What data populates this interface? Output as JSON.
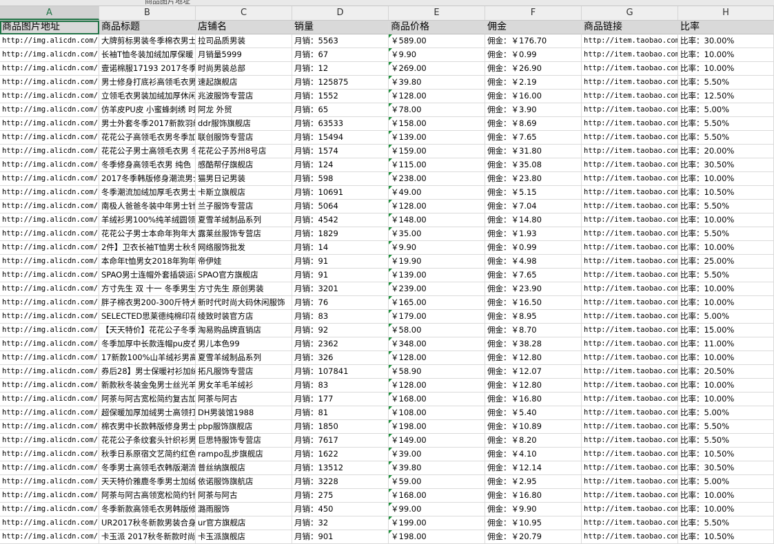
{
  "formula_bar": {
    "cell_text": "商品图片地址"
  },
  "columns": [
    "A",
    "B",
    "C",
    "D",
    "E",
    "F",
    "G",
    "H"
  ],
  "headers": [
    "商品图片地址",
    "商品标题",
    "店铺名",
    "销量",
    "商品价格",
    "佣金",
    "商品链接",
    "比率"
  ],
  "rows": [
    [
      "http://img.alicdn.com/ba",
      "大牌剪标男装冬季棉衣男士",
      "拉司品质男装",
      "月销：5563",
      "￥589.00",
      "佣金：￥176.70",
      "http://item.taobao.com/i",
      "比率：30.00%"
    ],
    [
      "http://img.alicdn.com/ba",
      "长袖T恤冬装加绒加厚保暖",
      "月销量5999",
      "月销：67",
      "￥9.90",
      "佣金：￥0.99",
      "http://item.taobao.com/i",
      "比率：10.00%"
    ],
    [
      "http://img.alicdn.com/ba",
      "壹诺棉服17193 2017冬季男",
      "时尚男装总部",
      "月销：12",
      "￥269.00",
      "佣金：￥26.90",
      "http://item.taobao.com/i",
      "比率：10.00%"
    ],
    [
      "http://img.alicdn.com/ba",
      "男士修身打底衫高领毛衣男",
      "速起旗舰店",
      "月销：125875",
      "￥39.80",
      "佣金：￥2.19",
      "http://item.taobao.com/i",
      "比率：5.50%"
    ],
    [
      "http://img.alicdn.com/ba",
      "立领毛衣男装加绒加厚休闲",
      "兆波服饰专营店",
      "月销：1552",
      "￥128.00",
      "佣金：￥16.00",
      "http://item.taobao.com/i",
      "比率：12.50%"
    ],
    [
      "http://img.alicdn.com/ba",
      "仿羊皮PU皮 小蜜蜂刺绣 时",
      "阿龙 外贸",
      "月销：65",
      "￥78.00",
      "佣金：￥3.90",
      "http://item.taobao.com/i",
      "比率：5.00%"
    ],
    [
      "http://img.alicdn.com/ba",
      "男士外套冬季2017新款羽绒",
      "ddr服饰旗舰店",
      "月销：63533",
      "￥158.00",
      "佣金：￥8.69",
      "http://item.taobao.com/i",
      "比率：5.50%"
    ],
    [
      "http://img.alicdn.com/ba",
      "花花公子高领毛衣男冬季加",
      "联创服饰专营店",
      "月销：15494",
      "￥139.00",
      "佣金：￥7.65",
      "http://item.taobao.com/i",
      "比率：5.50%"
    ],
    [
      "http://img.alicdn.com/ba",
      "花花公子男士高领毛衣男 冬",
      "花花公子苏州8号店",
      "月销：1574",
      "￥159.00",
      "佣金：￥31.80",
      "http://item.taobao.com/i",
      "比率：20.00%"
    ],
    [
      "http://img.alicdn.com/ba",
      "冬季修身高领毛衣男 纯色",
      "感酷帮仔旗舰店",
      "月销：124",
      "￥115.00",
      "佣金：￥35.08",
      "http://item.taobao.com/i",
      "比率：30.50%"
    ],
    [
      "http://img.alicdn.com/ba",
      "2017冬季韩版修身潮流男士",
      "猫男日记男装",
      "月销：598",
      "￥238.00",
      "佣金：￥23.80",
      "http://item.taobao.com/i",
      "比率：10.00%"
    ],
    [
      "http://img.alicdn.com/ba",
      "冬季潮流加绒加厚毛衣男士",
      "卡斯立旗舰店",
      "月销：10691",
      "￥49.00",
      "佣金：￥5.15",
      "http://item.taobao.com/i",
      "比率：10.50%"
    ],
    [
      "http://img.alicdn.com/ba",
      "南极人爸爸冬装中年男士针",
      "兰子服饰专营店",
      "月销：5064",
      "￥128.00",
      "佣金：￥7.04",
      "http://item.taobao.com/i",
      "比率：5.50%"
    ],
    [
      "http://img.alicdn.com/ba",
      "羊绒衫男100%纯羊绒圆领羊",
      "夏雪羊绒制品系列",
      "月销：4542",
      "￥148.00",
      "佣金：￥14.80",
      "http://item.taobao.com/i",
      "比率：10.00%"
    ],
    [
      "http://img.alicdn.com/ba",
      "花花公子男士本命年狗年大",
      "露莱丝服饰专营店",
      "月销：1829",
      "￥35.00",
      "佣金：￥1.93",
      "http://item.taobao.com/i",
      "比率：5.50%"
    ],
    [
      "http://img.alicdn.com/ba",
      "2件】卫衣长袖T恤男士秋冬",
      "网络服饰批发",
      "月销：14",
      "￥9.90",
      "佣金：￥0.99",
      "http://item.taobao.com/i",
      "比率：10.00%"
    ],
    [
      "http://img.alicdn.com/ba",
      "本命年t恤男女2018年狗年红",
      "帝伊娃",
      "月销：91",
      "￥19.90",
      "佣金：￥4.98",
      "http://item.taobao.com/i",
      "比率：25.00%"
    ],
    [
      "http://img.alicdn.com/ba",
      "SPAO男士连帽外套插袋运动",
      "SPAO官方旗舰店",
      "月销：91",
      "￥139.00",
      "佣金：￥7.65",
      "http://item.taobao.com/i",
      "比率：5.50%"
    ],
    [
      "http://img.alicdn.com/ba",
      "方寸先生 双 十一 冬季男生",
      "方寸先生 原创男装",
      "月销：3201",
      "￥239.00",
      "佣金：￥23.90",
      "http://item.taobao.com/i",
      "比率：10.00%"
    ],
    [
      "http://img.alicdn.com/ba",
      "胖子棉衣男200-300斤特大码",
      "新时代时尚大码休闲服饰",
      "月销：76",
      "￥165.00",
      "佣金：￥16.50",
      "http://item.taobao.com/i",
      "比率：10.00%"
    ],
    [
      "http://img.alicdn.com/ba",
      "SELECTED思莱德纯棉印花男",
      "绫致时装官方店",
      "月销：83",
      "￥179.00",
      "佣金：￥8.95",
      "http://item.taobao.com/i",
      "比率：5.00%"
    ],
    [
      "http://img.alicdn.com/ba",
      "【天天特价】花花公子冬季",
      "淘易购品牌直销店",
      "月销：92",
      "￥58.00",
      "佣金：￥8.70",
      "http://item.taobao.com/i",
      "比率：15.00%"
    ],
    [
      "http://img.alicdn.com/ba",
      "冬季加厚中长款连帽pu皮衣",
      "男儿本色99",
      "月销：2362",
      "￥348.00",
      "佣金：￥38.28",
      "http://item.taobao.com/i",
      "比率：11.00%"
    ],
    [
      "http://img.alicdn.com/ba",
      "17新款100%山羊绒衫男高领",
      "夏雪羊绒制品系列",
      "月销：326",
      "￥128.00",
      "佣金：￥12.80",
      "http://item.taobao.com/i",
      "比率：10.00%"
    ],
    [
      "http://img.alicdn.com/ba",
      "券后28】男士保暖衬衫加绒",
      "拓凡服饰专营店",
      "月销：107841",
      "￥58.90",
      "佣金：￥12.07",
      "http://item.taobao.com/i",
      "比率：20.50%"
    ],
    [
      "http://img.alicdn.com/ba",
      "新款秋冬装金兔男士丝光羊",
      "男女羊毛羊绒衫",
      "月销：83",
      "￥128.00",
      "佣金：￥12.80",
      "http://item.taobao.com/i",
      "比率：10.00%"
    ],
    [
      "http://img.alicdn.com/ba",
      "阿茶与阿古宽松简约复古加",
      "阿茶与阿古",
      "月销：177",
      "￥168.00",
      "佣金：￥16.80",
      "http://item.taobao.com/i",
      "比率：10.00%"
    ],
    [
      "http://img.alicdn.com/ba",
      "超保暖加厚加绒男士高领打",
      "DH男装馆1988",
      "月销：81",
      "￥108.00",
      "佣金：￥5.40",
      "http://item.taobao.com/i",
      "比率：5.00%"
    ],
    [
      "http://img.alicdn.com/ba",
      "棉衣男中长款韩版修身男士",
      "pbp服饰旗舰店",
      "月销：1850",
      "￥198.00",
      "佣金：￥10.89",
      "http://item.taobao.com/i",
      "比率：5.50%"
    ],
    [
      "http://img.alicdn.com/ba",
      "花花公子条纹套头针织衫男",
      "巨思特服饰专营店",
      "月销：7617",
      "￥149.00",
      "佣金：￥8.20",
      "http://item.taobao.com/i",
      "比率：5.50%"
    ],
    [
      "http://img.alicdn.com/ba",
      "秋季日系原宿文艺简约红色",
      "rampo乱步旗舰店",
      "月销：1622",
      "￥39.00",
      "佣金：￥4.10",
      "http://item.taobao.com/i",
      "比率：10.50%"
    ],
    [
      "http://img.alicdn.com/ba",
      "冬季男士高领毛衣韩版潮流",
      "普丝纳旗舰店",
      "月销：13512",
      "￥39.80",
      "佣金：￥12.14",
      "http://item.taobao.com/i",
      "比率：30.50%"
    ],
    [
      "http://img.alicdn.com/ba",
      "天天特价雅鹿冬季男士加绒",
      "依诺服饰旗航店",
      "月销：3228",
      "￥59.00",
      "佣金：￥2.95",
      "http://item.taobao.com/i",
      "比率：5.00%"
    ],
    [
      "http://img.alicdn.com/ba",
      "阿茶与阿古高领宽松简约针",
      "阿茶与阿古",
      "月销：275",
      "￥168.00",
      "佣金：￥16.80",
      "http://item.taobao.com/i",
      "比率：10.00%"
    ],
    [
      "http://img.alicdn.com/ba",
      "冬季新款高领毛衣男韩版修",
      "潞雨服饰",
      "月销：450",
      "￥99.00",
      "佣金：￥9.90",
      "http://item.taobao.com/i",
      "比率：10.00%"
    ],
    [
      "http://img.alicdn.com/ba",
      "UR2017秋冬新款男装合身长",
      "ur官方旗舰店",
      "月销：32",
      "￥199.00",
      "佣金：￥10.95",
      "http://item.taobao.com/i",
      "比率：5.50%"
    ],
    [
      "http://img.alicdn.com/ba",
      "卡玉派 2017秋冬新款时尚",
      "卡玉派旗舰店",
      "月销：901",
      "￥198.00",
      "佣金：￥20.79",
      "http://item.taobao.com/i",
      "比率：10.50%"
    ]
  ]
}
